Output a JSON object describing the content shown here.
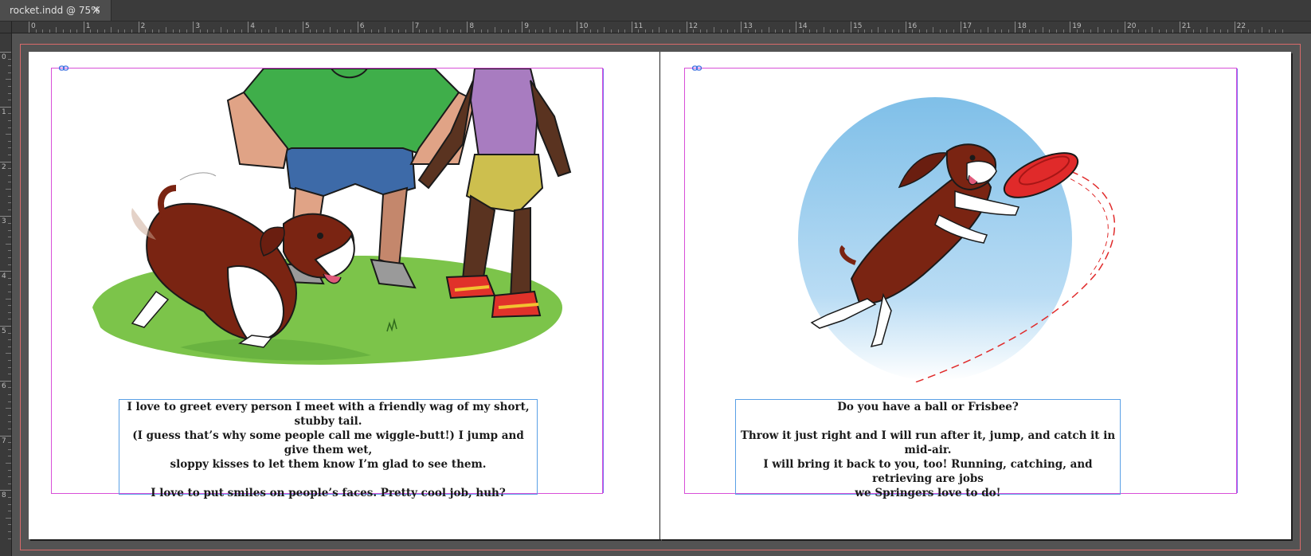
{
  "tab": {
    "title": "rocket.indd @ 75%",
    "close_glyph": "×"
  },
  "ruler": {
    "h_labels": [
      "0",
      "1",
      "2",
      "3",
      "4",
      "5",
      "6",
      "7",
      "8",
      "9",
      "10",
      "11",
      "12",
      "13",
      "14",
      "15",
      "16",
      "17",
      "18",
      "19",
      "20",
      "21",
      "22"
    ],
    "v_labels": [
      "0",
      "1",
      "2",
      "3",
      "4",
      "5",
      "6",
      "7",
      "8"
    ]
  },
  "left_page": {
    "illustration": "dog greeting people on grass",
    "text": {
      "line1": "I love to greet every person I meet with a friendly wag of my short, stubby tail.",
      "line2": "(I guess that’s why some people call me wiggle-butt!) I jump and give them wet,",
      "line3": "sloppy kisses to let them know I’m glad to see them.",
      "line4": "I love to put smiles on people’s faces. Pretty cool job, huh?"
    }
  },
  "right_page": {
    "illustration": "dog leaping for frisbee",
    "text": {
      "line1": "Do you have a ball or Frisbee?",
      "line2": "Throw it just right and I will run after it, jump, and catch it in mid-air.",
      "line3": "I will bring it back to you, too! Running, catching, and retrieving are jobs",
      "line4": "we Springers love to do!"
    }
  },
  "colors": {
    "pasteboard": "#535353",
    "margin_guide": "#d84fd8",
    "bleed_guide": "#d86a6a",
    "text_frame": "#5aa0e6",
    "grass": "#7cc44a",
    "shirt_green": "#3fae4a",
    "shirt_purple": "#a87cc0",
    "sky_blue": "#7fbfe8",
    "frisbee_red": "#e02a2a",
    "dog_brown": "#7a2412"
  }
}
